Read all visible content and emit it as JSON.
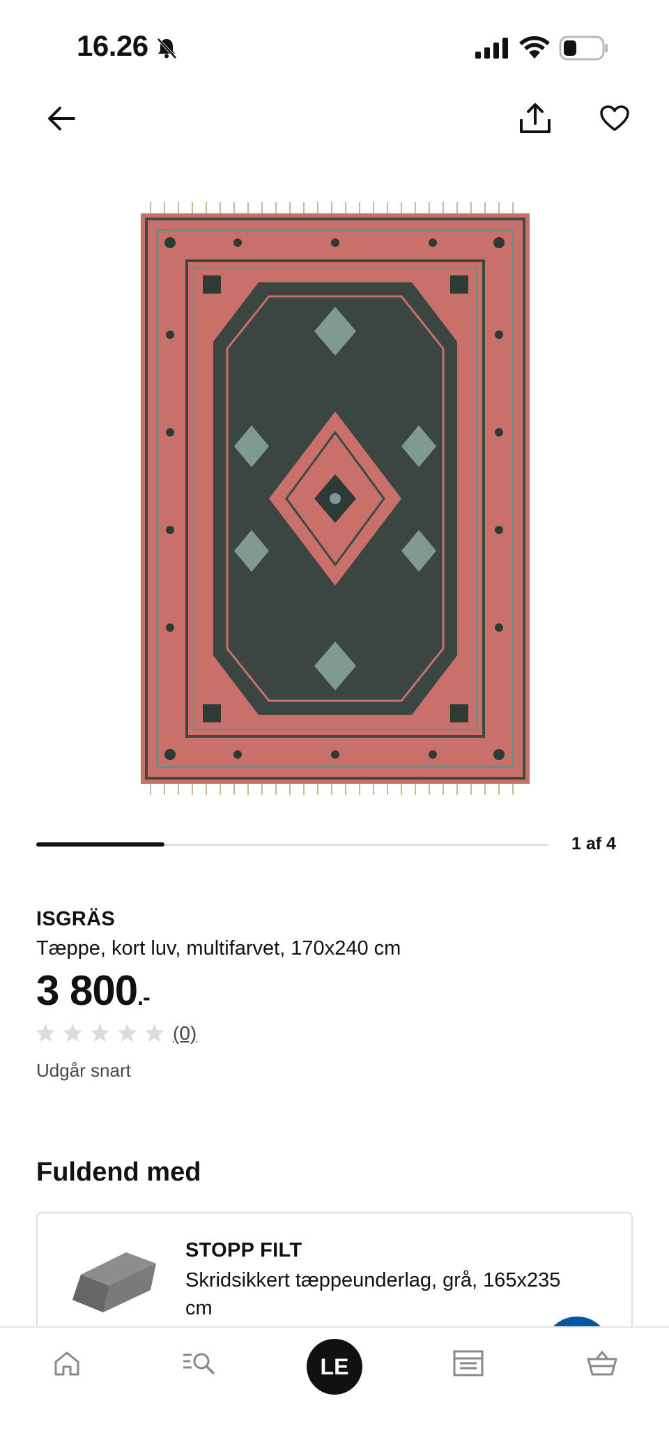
{
  "status_bar": {
    "time": "16.26"
  },
  "carousel": {
    "indicator": "1 af 4",
    "progress_fraction": 0.25
  },
  "product": {
    "brand": "ISGRÄS",
    "description": "Tæppe, kort luv, multifarvet, 170x240 cm",
    "price": "3 800",
    "price_suffix": ".-",
    "rating": 0,
    "rating_max": 5,
    "review_count": "(0)",
    "availability": "Udgår snart"
  },
  "complete_with": {
    "title": "Fuldend med",
    "item": {
      "name": "STOPP FILT",
      "description": "Skridsikkert tæppeunderlag, grå, 165x235 cm"
    }
  },
  "bottom_nav": {
    "profile_initials": "LE",
    "tabs": [
      "home-icon",
      "search-list-icon",
      "profile",
      "store-icon",
      "cart-icon"
    ]
  },
  "colors": {
    "rug_red": "#c9706a",
    "rug_dark": "#2e3a35",
    "rug_teal": "#6f8c86",
    "ikea_blue": "#0058a3",
    "star_empty": "#dcdcdc"
  }
}
